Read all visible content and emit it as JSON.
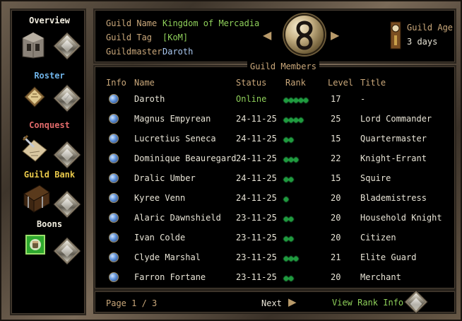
{
  "sidebar": {
    "overview": "Overview",
    "roster": "Roster",
    "conquest": "Conquest",
    "guild_bank": "Guild Bank",
    "boons": "Boons"
  },
  "header": {
    "guild_name_label": "Guild Name",
    "guild_name": "Kingdom of Mercadia",
    "guild_tag_label": "Guild Tag",
    "guild_tag": "[KoM]",
    "guildmaster_label": "Guildmaster",
    "guildmaster": "Daroth",
    "guild_age_label": "Guild Age",
    "guild_age": "3 days"
  },
  "members": {
    "title": "Guild Members",
    "columns": [
      "Info",
      "Name",
      "Status",
      "Rank",
      "Level",
      "Title"
    ],
    "rows": [
      {
        "name": "Daroth",
        "status": "Online",
        "rank": 5,
        "level": "17",
        "title": "-"
      },
      {
        "name": "Magnus Empyrean",
        "status": "24-11-25",
        "rank": 4,
        "level": "25",
        "title": "Lord Commander"
      },
      {
        "name": "Lucretius Seneca",
        "status": "24-11-25",
        "rank": 2,
        "level": "15",
        "title": "Quartermaster"
      },
      {
        "name": "Dominique Beauregard",
        "status": "24-11-25",
        "rank": 3,
        "level": "22",
        "title": "Knight-Errant"
      },
      {
        "name": "Dralic Umber",
        "status": "24-11-25",
        "rank": 2,
        "level": "15",
        "title": "Squire"
      },
      {
        "name": "Kyree Venn",
        "status": "24-11-25",
        "rank": 1,
        "level": "20",
        "title": "Blademistress"
      },
      {
        "name": "Alaric Dawnshield",
        "status": "23-11-25",
        "rank": 2,
        "level": "20",
        "title": "Household Knight"
      },
      {
        "name": "Ivan Colde",
        "status": "23-11-25",
        "rank": 2,
        "level": "20",
        "title": "Citizen"
      },
      {
        "name": "Clyde Marshal",
        "status": "23-11-25",
        "rank": 3,
        "level": "21",
        "title": "Elite Guard"
      },
      {
        "name": "Farron Fortane",
        "status": "23-11-25",
        "rank": 2,
        "level": "20",
        "title": "Merchant"
      }
    ]
  },
  "footer": {
    "page_label": "Page 1 / 3",
    "next_label": "Next",
    "view_rank_info": "View Rank Info"
  },
  "colors": {
    "gold_label": "#c9a77a",
    "green_value": "#8fd05a",
    "online": "#8fd05a",
    "blue_value": "#a9c8f0",
    "text": "#e8e4d6"
  },
  "icons": {
    "overview": "tower-icon",
    "roster": "book-icon",
    "conquest": "map-icon",
    "guild_bank": "chest-icon",
    "boons": "fist-icon"
  }
}
